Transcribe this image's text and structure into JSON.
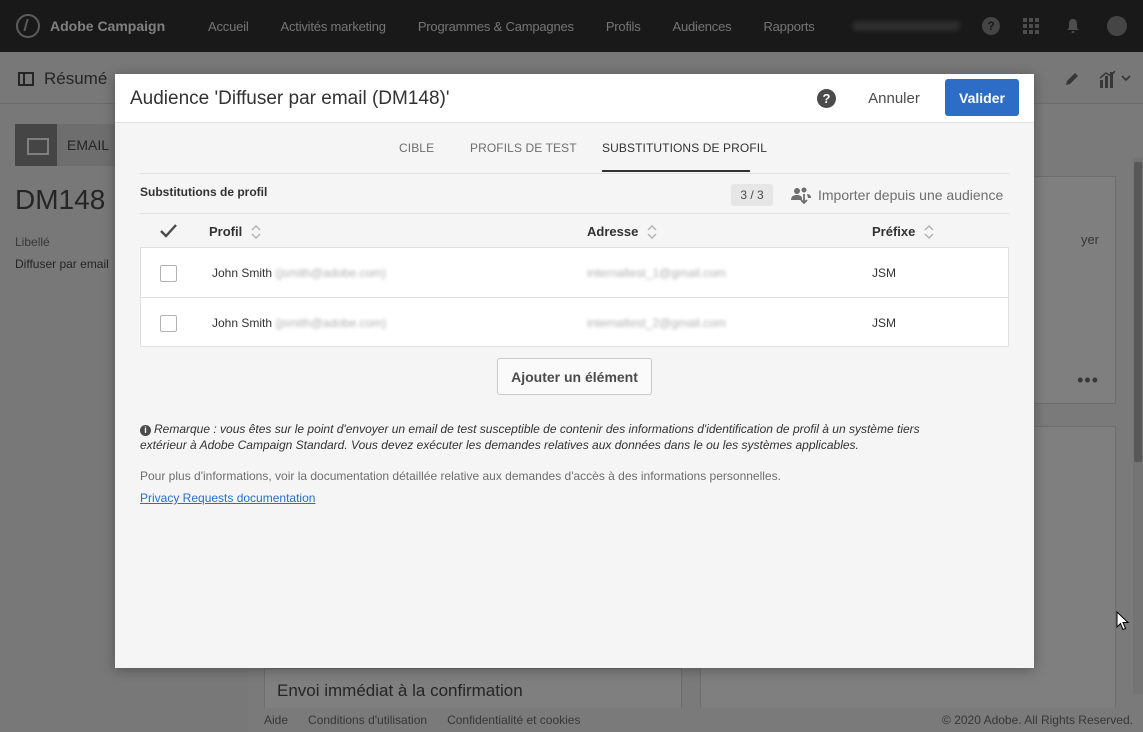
{
  "app": {
    "brand": "Adobe Campaign",
    "nav_items": [
      "Accueil",
      "Activités marketing",
      "Programmes & Campagnes",
      "Profils",
      "Audiences",
      "Rapports"
    ],
    "user": "campaignautomation"
  },
  "page": {
    "summary_label": "Résumé",
    "channel_label": "EMAIL",
    "delivery_id": "DM148",
    "label_title": "Libellé",
    "label_value": "Diffuser par email",
    "right_card_text": "yer",
    "bottom_card_text": "Envoi immédiat à la confirmation",
    "footer_links": [
      "Aide",
      "Conditions d'utilisation",
      "Confidentialité et cookies"
    ],
    "copyright": "© 2020 Adobe. All Rights Reserved."
  },
  "modal": {
    "title": "Audience 'Diffuser par email (DM148)'",
    "help_glyph": "?",
    "cancel_label": "Annuler",
    "validate_label": "Valider",
    "tabs": [
      "CIBLE",
      "PROFILS DE TEST",
      "SUBSTITUTIONS DE PROFIL"
    ],
    "active_tab": "SUBSTITUTIONS DE PROFIL",
    "section_title": "Substitutions de profil",
    "count": "3 / 3",
    "import_label": "Importer depuis une audience",
    "columns": {
      "profile": "Profil",
      "address": "Adresse",
      "prefix": "Préfixe"
    },
    "rows": [
      {
        "name": "John Smith",
        "email": "(jsmith@adobe.com)",
        "address": "internaltest_1@gmail.com",
        "prefix": "JSM",
        "checked": false
      },
      {
        "name": "John Smith",
        "email": "(jsmith@adobe.com)",
        "address": "internaltest_2@gmail.com",
        "prefix": "JSM",
        "checked": false
      }
    ],
    "add_label": "Ajouter un élément",
    "note_icon": "i",
    "note_text": "Remarque : vous êtes sur le point d'envoyer un email de test susceptible de contenir des informations d'identification de profil à un système tiers extérieur à Adobe Campaign Standard. Vous devez exécuter les demandes relatives aux données dans le ou les systèmes applicables.",
    "more_info": "Pour plus d'informations, voir la documentation détaillée relative aux demandes d'accès à des informations personnelles.",
    "privacy_link": "Privacy Requests documentation"
  },
  "colors": {
    "accent": "#2d6dc6",
    "topbar": "#323232",
    "link": "#2d6dc6"
  }
}
